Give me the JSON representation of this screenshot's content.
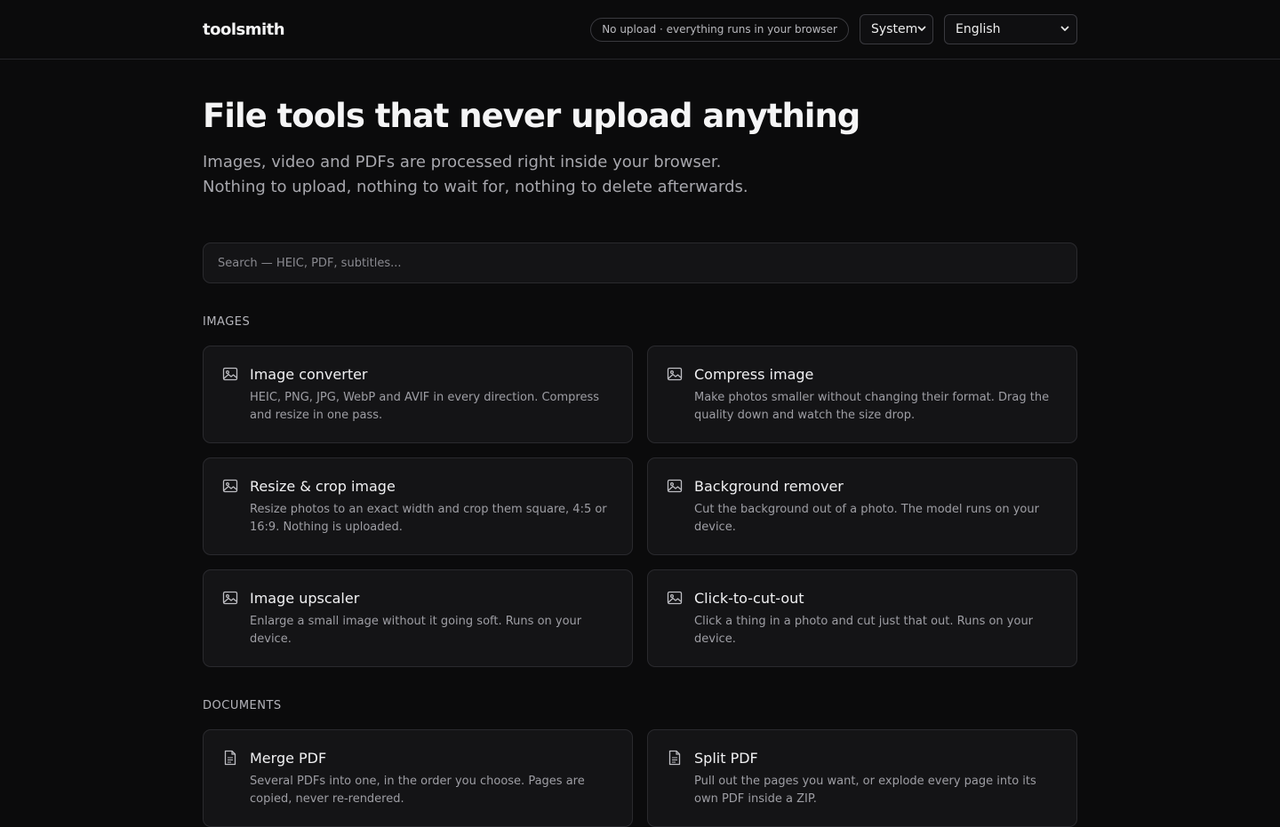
{
  "header": {
    "brand": "toolsmith",
    "privacy_pill": "No upload · everything runs in your browser",
    "theme_select": "System",
    "language_select": "English"
  },
  "hero": {
    "title": "File tools that never upload anything",
    "lead": "Images, video and PDFs are processed right inside your browser. Nothing to upload, nothing to wait for, nothing to delete afterwards."
  },
  "search": {
    "placeholder": "Search — HEIC, PDF, subtitles..."
  },
  "sections": {
    "images": {
      "label": "IMAGES",
      "cards": [
        {
          "title": "Image converter",
          "desc": "HEIC, PNG, JPG, WebP and AVIF in every direction. Compress and resize in one pass.",
          "icon": "image-icon"
        },
        {
          "title": "Compress image",
          "desc": "Make photos smaller without changing their format. Drag the quality down and watch the size drop.",
          "icon": "image-icon"
        },
        {
          "title": "Resize & crop image",
          "desc": "Resize photos to an exact width and crop them square, 4:5 or 16:9. Nothing is uploaded.",
          "icon": "image-icon"
        },
        {
          "title": "Background remover",
          "desc": "Cut the background out of a photo. The model runs on your device.",
          "icon": "image-icon"
        },
        {
          "title": "Image upscaler",
          "desc": "Enlarge a small image without it going soft. Runs on your device.",
          "icon": "image-icon"
        },
        {
          "title": "Click-to-cut-out",
          "desc": "Click a thing in a photo and cut just that out. Runs on your device.",
          "icon": "image-icon"
        }
      ]
    },
    "documents": {
      "label": "DOCUMENTS",
      "cards": [
        {
          "title": "Merge PDF",
          "desc": "Several PDFs into one, in the order you choose. Pages are copied, never re-rendered.",
          "icon": "document-icon"
        },
        {
          "title": "Split PDF",
          "desc": "Pull out the pages you want, or explode every page into its own PDF inside a ZIP.",
          "icon": "document-icon"
        }
      ]
    }
  }
}
